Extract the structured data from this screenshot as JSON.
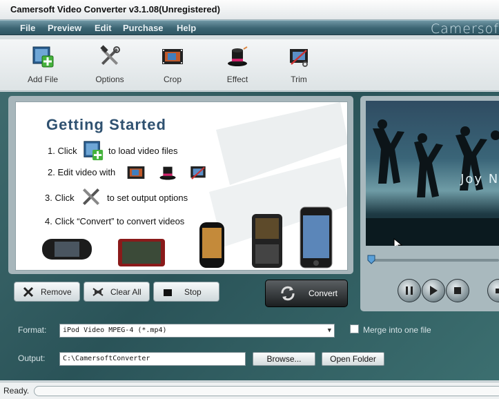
{
  "window": {
    "title": "Camersoft Video Converter v3.1.08(Unregistered)"
  },
  "menu": {
    "items": [
      "File",
      "Preview",
      "Edit",
      "Purchase",
      "Help"
    ],
    "brand": "Camersof"
  },
  "toolbar": {
    "add_file": "Add File",
    "options": "Options",
    "crop": "Crop",
    "effect": "Effect",
    "trim": "Trim"
  },
  "getting_started": {
    "title": "Getting  Started",
    "step1_pre": "1. Click",
    "step1_post": "to load video files",
    "step2": "2. Edit video with",
    "step3_pre": "3. Click",
    "step3_post": "to set output options",
    "step4": "4. Click “Convert” to convert videos"
  },
  "actions": {
    "remove": "Remove",
    "clear_all": "Clear All",
    "stop": "Stop",
    "convert": "Convert"
  },
  "preview": {
    "overlay_text": "Joy Now"
  },
  "format": {
    "label": "Format:",
    "value": "iPod Video MPEG-4 (*.mp4)",
    "merge_label": "Merge into one file"
  },
  "output": {
    "label": "Output:",
    "value": "C:\\CamersoftConverter",
    "browse": "Browse...",
    "open_folder": "Open Folder"
  },
  "status": {
    "text": "Ready."
  },
  "colors": {
    "accent": "#2f5170",
    "menubar": "#3b6472",
    "panel_bg": "#2a5358"
  }
}
